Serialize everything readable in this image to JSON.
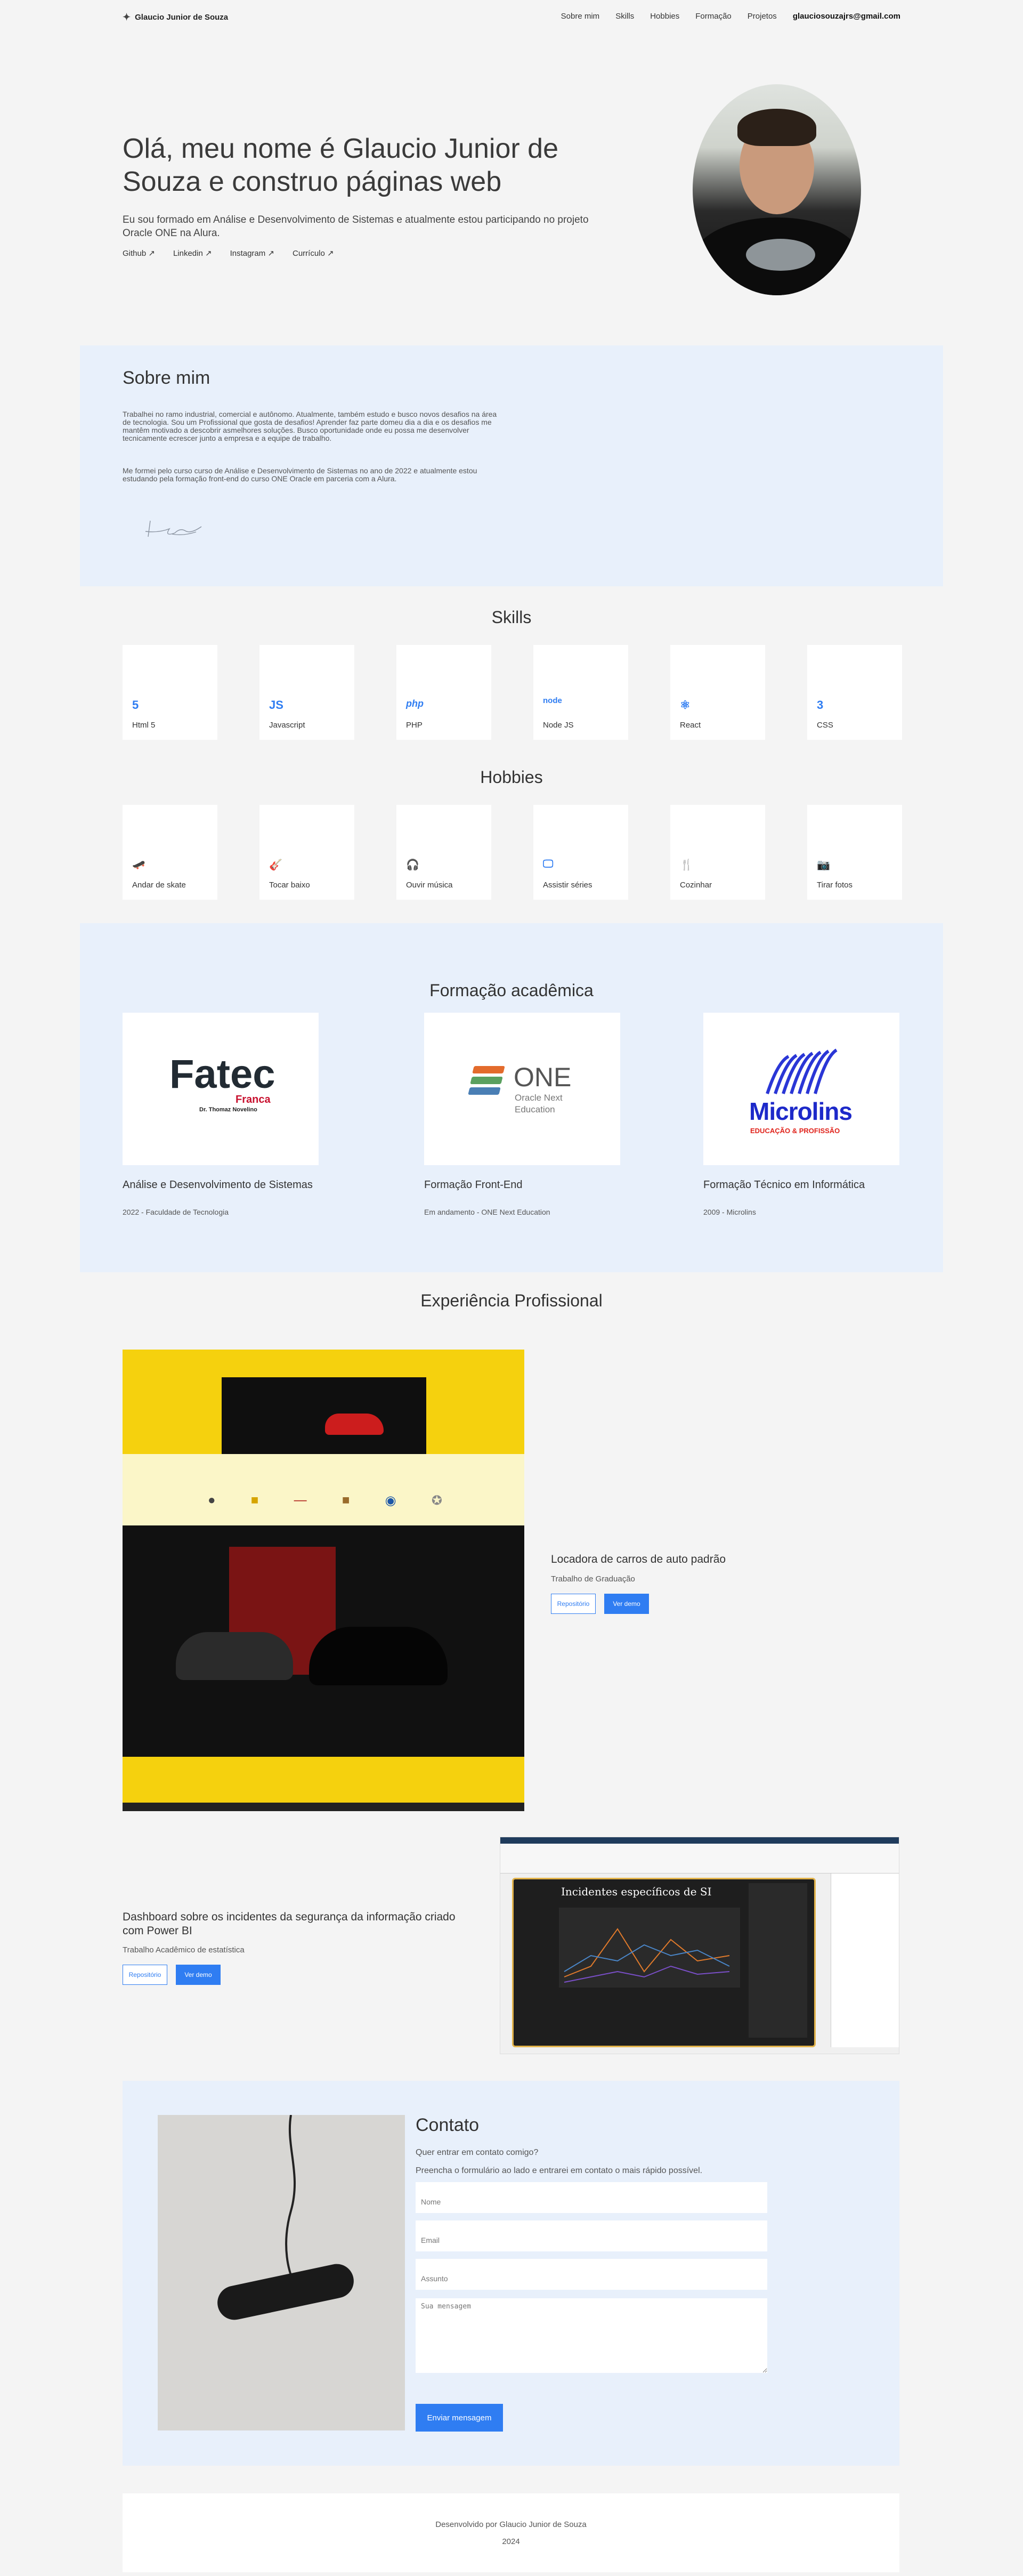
{
  "nav": {
    "brand": "Glaucio Junior de Souza",
    "items": [
      "Sobre mim",
      "Skills",
      "Hobbies",
      "Formação",
      "Projetos"
    ],
    "email": "glauciosouzajrs@gmail.com"
  },
  "hero": {
    "title": "Olá, meu nome é Glaucio Junior de Souza e construo páginas web",
    "text": "Eu sou formado em Análise e Desenvolvimento de Sistemas e atualmente estou participando no projeto Oracle ONE na Alura.",
    "links": [
      "Github ↗",
      "Linkedin ↗",
      "Instagram ↗",
      "Currículo ↗"
    ]
  },
  "about": {
    "title": "Sobre mim",
    "p1": "Trabalhei no ramo industrial, comercial e autônomo. Atualmente, também estudo e busco novos desafios na área de tecnologia. Sou um Profissional que gosta de desafios! Aprender faz parte domeu dia a dia e os desafios me mantêm motivado a descobrir asmelhores soluções. Busco oportunidade onde eu possa me desenvolver tecnicamente ecrescer junto a empresa e a equipe de trabalho.",
    "p2": "Me formei pelo curso curso de Análise e Desenvolvimento de Sistemas no ano de 2022 e atualmente estou estudando pela formação front-end do curso ONE Oracle em parceria com a Alura."
  },
  "skills": {
    "title": "Skills",
    "items": [
      {
        "label": "Html 5",
        "icon": "html5-icon",
        "glyph": "5"
      },
      {
        "label": "Javascript",
        "icon": "javascript-icon",
        "glyph": "JS"
      },
      {
        "label": "PHP",
        "icon": "php-icon",
        "glyph": "php"
      },
      {
        "label": "Node JS",
        "icon": "nodejs-icon",
        "glyph": "node"
      },
      {
        "label": "React",
        "icon": "react-icon",
        "glyph": "⚛"
      },
      {
        "label": "CSS",
        "icon": "css-icon",
        "glyph": "3"
      }
    ]
  },
  "hobbies": {
    "title": "Hobbies",
    "items": [
      {
        "label": "Andar de skate",
        "icon": "skate-icon",
        "glyph": "🛹"
      },
      {
        "label": "Tocar baixo",
        "icon": "guitar-icon",
        "glyph": "🎸"
      },
      {
        "label": "Ouvir música",
        "icon": "headphones-icon",
        "glyph": "🎧"
      },
      {
        "label": "Assistir séries",
        "icon": "tv-icon",
        "glyph": "🖵"
      },
      {
        "label": "Cozinhar",
        "icon": "utensils-icon",
        "glyph": "🍴"
      },
      {
        "label": "Tirar fotos",
        "icon": "camera-icon",
        "glyph": "📷"
      }
    ]
  },
  "formacao": {
    "title": "Formação acadêmica",
    "items": [
      {
        "name": "Análise e Desenvolvimento de Sistemas",
        "sub": "2022 - Faculdade de Tecnologia",
        "logo_main": "Fatec",
        "logo_sub": "Franca",
        "logo_extra": "Dr. Thomaz Novelino"
      },
      {
        "name": "Formação Front-End",
        "sub": "Em andamento - ONE Next Education",
        "logo_main": "ONE",
        "logo_sub": "Oracle Next",
        "logo_extra": "Education"
      },
      {
        "name": "Formação Técnico em Informática",
        "sub": "2009 - Microlins",
        "logo_main": "Microlins",
        "logo_sub": "EDUCAÇÃO & PROFISSÃO",
        "logo_extra": ""
      }
    ]
  },
  "experiencia": {
    "title": "Experiência Profissional",
    "projects": [
      {
        "name": "Locadora de carros de auto padrão",
        "sub": "Trabalho de Graduação",
        "btn_repo": "Repositório",
        "btn_demo": "Ver demo"
      },
      {
        "name": "Dashboard sobre os incidentes da segurança da informação criado com Power BI",
        "sub": "Trabalho Acadêmico de estatística",
        "btn_repo": "Repositório",
        "btn_demo": "Ver demo",
        "dash_title": "Incidentes específicos de SI"
      }
    ]
  },
  "contato": {
    "title": "Contato",
    "question": "Quer entrar em contato comigo?",
    "desc": "Preencha o formulário ao lado e entrarei em contato o mais rápido possível.",
    "name_ph": "Nome",
    "email_ph": "Email",
    "subject_ph": "Assunto",
    "message_ph": "Sua mensagem",
    "send": "Enviar mensagem"
  },
  "footer": {
    "line1": "Desenvolvido por Glaucio Junior de Souza",
    "line2": "2024"
  },
  "colors": {
    "accent": "#2f7df2",
    "section_bg": "#e8f0fb",
    "page_bg": "#f4f4f4"
  }
}
